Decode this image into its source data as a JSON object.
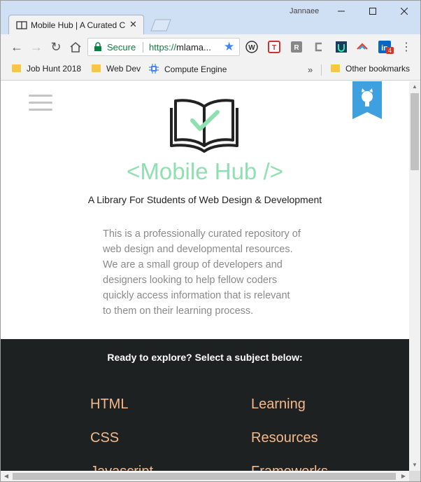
{
  "window": {
    "user_name": "Jannaee",
    "tab_title": "Mobile Hub | A Curated C"
  },
  "toolbar": {
    "secure_label": "Secure",
    "url_scheme": "https://",
    "url_host": "mlama...",
    "extensions": [
      "w-extension-icon",
      "t-extension-icon",
      "r-extension-icon",
      "c-extension-icon",
      "u-extension-icon",
      "arrow-extension-icon",
      "linkedin-icon"
    ],
    "linkedin_badge": "4"
  },
  "bookmarks": {
    "items": [
      {
        "label": "Job Hunt 2018",
        "icon": "folder-icon"
      },
      {
        "label": "Web Dev",
        "icon": "folder-icon"
      },
      {
        "label": "Compute Engine",
        "icon": "compute-engine-icon"
      }
    ],
    "overflow": "»",
    "other": "Other bookmarks"
  },
  "page": {
    "title": "<Mobile Hub />",
    "subtitle": "A Library For Students of Web Design & Development",
    "intro_lines": [
      "This is a professionally curated repository of",
      "web design and developmental resources.",
      "We are a small group of developers and",
      "designers looking to help fellow coders",
      "quickly access information that is relevant",
      "to them on their learning process."
    ],
    "explore_heading": "Ready to explore? Select a subject below:",
    "subjects_left": [
      "HTML",
      "CSS",
      "Javascript"
    ],
    "subjects_right": [
      "Learning",
      "Resources",
      "Frameworks"
    ]
  },
  "colors": {
    "title_green": "#8fe0b0",
    "subject_orange": "#f4b98b",
    "dark_bg": "#1e2122",
    "github_ribbon": "#3fa0e0"
  }
}
